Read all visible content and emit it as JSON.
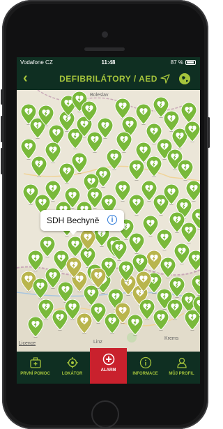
{
  "status": {
    "carrier": "Vodafone CZ",
    "time": "11:48",
    "battery": "87 %"
  },
  "nav": {
    "title": "DEFIBRILÁTORY / AED",
    "back_icon": "chevron-left-icon",
    "location_icon": "location-arrow-icon",
    "globe_icon": "globe-icon"
  },
  "map": {
    "place_labels": [
      "Boleslav",
      "Linz",
      "Krems"
    ],
    "legal_text": "Licence",
    "callout": {
      "name": "SDH Bechyně",
      "info_icon": "info-icon"
    },
    "pin_colors": {
      "green": "#79b93a",
      "olive": "#b9b54d"
    }
  },
  "tabs": [
    {
      "label": "PRVNÍ POMOC",
      "icon": "first-aid-kit-icon"
    },
    {
      "label": "LOKÁTOR",
      "icon": "crosshair-icon"
    },
    {
      "label": "ALARM",
      "icon": "plus-circle-icon",
      "active": true
    },
    {
      "label": "INFORMACE",
      "icon": "info-icon"
    },
    {
      "label": "MŮJ PROFIL",
      "icon": "user-icon"
    }
  ],
  "colors": {
    "bar": "#0f2f22",
    "accent": "#a5c43c",
    "alarm": "#c9212d"
  }
}
